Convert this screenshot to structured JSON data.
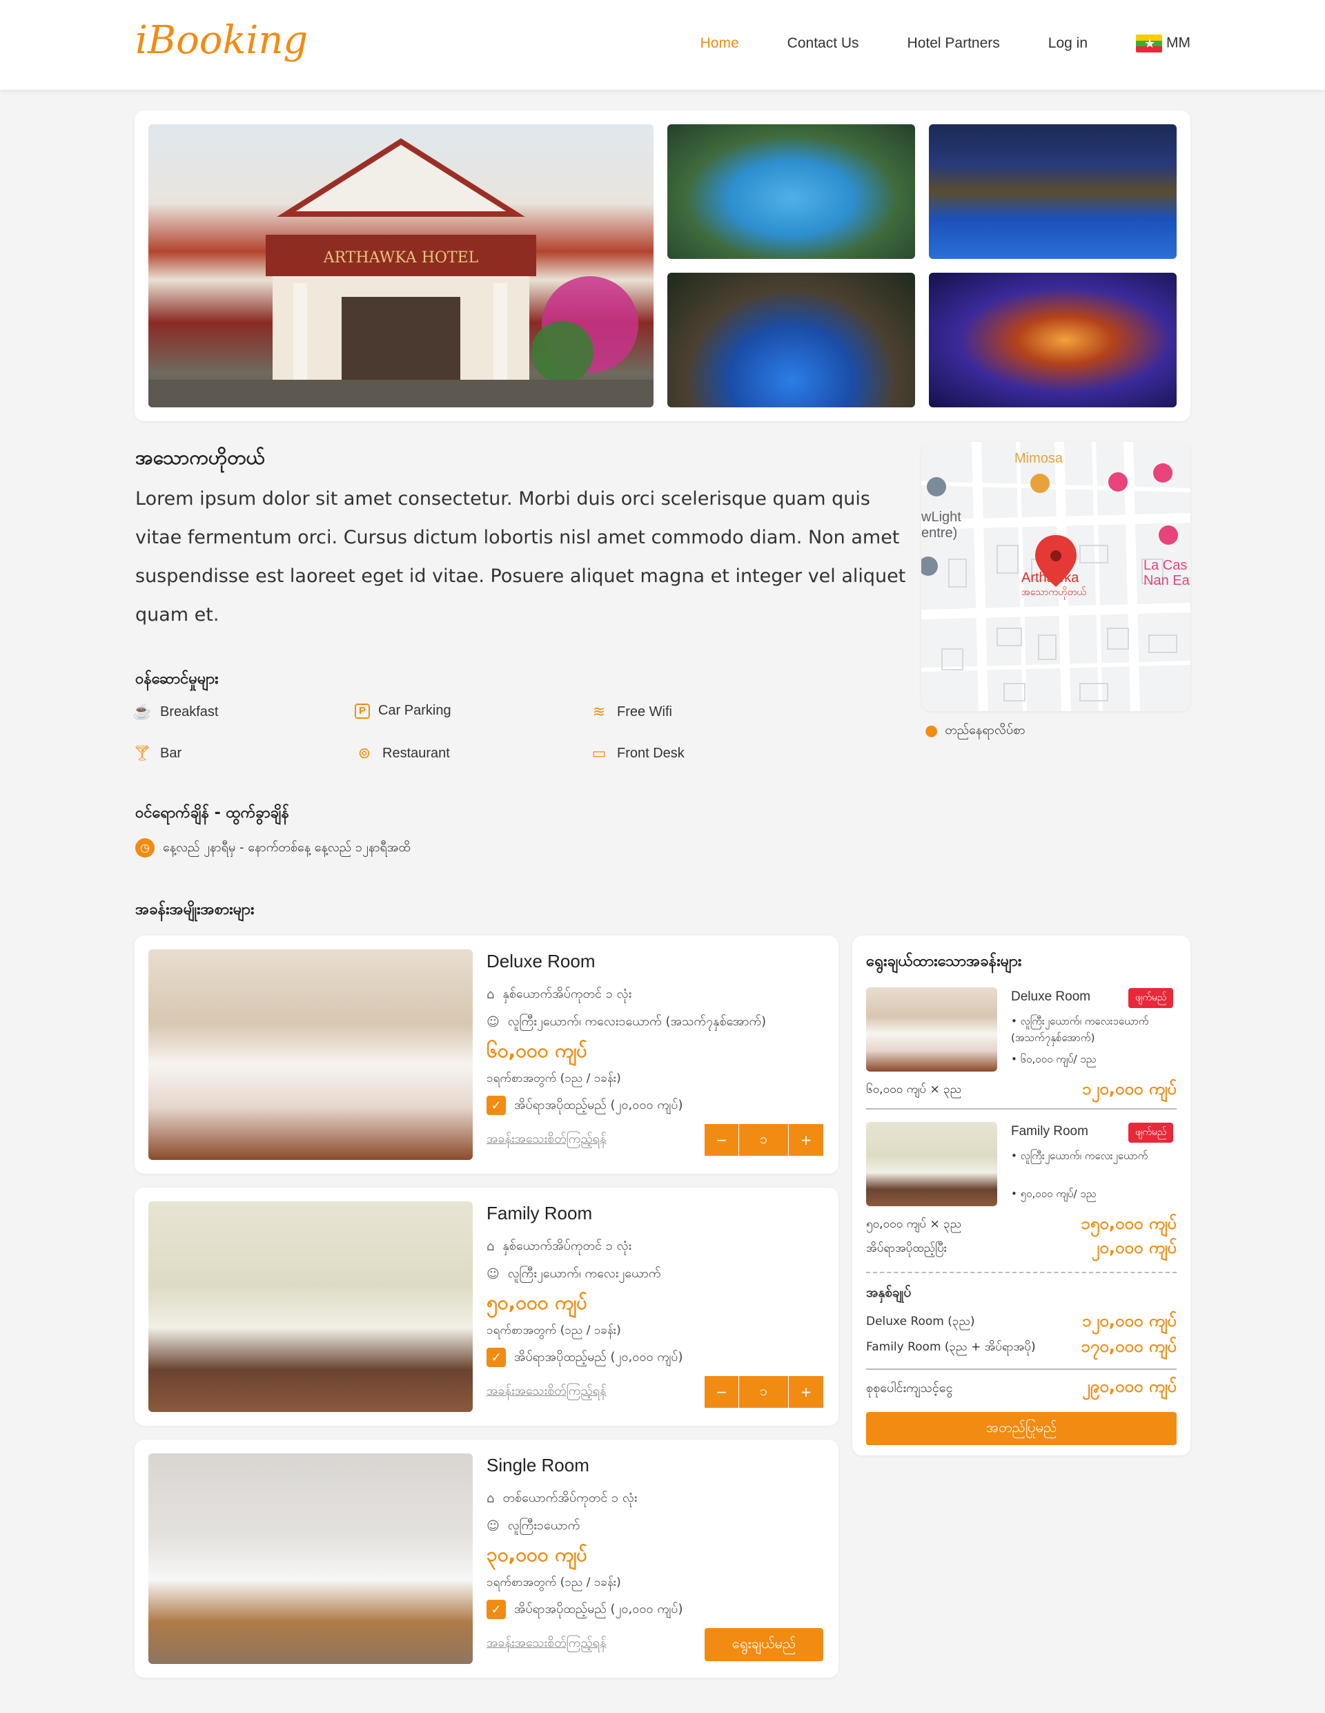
{
  "brand": {
    "logo": "iBooking",
    "accent": "#f28b12"
  },
  "nav": {
    "home": "Home",
    "contact": "Contact Us",
    "partners": "Hotel Partners",
    "login": "Log in",
    "lang": "MM"
  },
  "hotel": {
    "name": "အသောကဟိုတယ်",
    "description": "Lorem ipsum dolor sit amet consectetur. Morbi duis orci scelerisque quam quis vitae fermentum orci. Cursus dictum lobortis nisl amet commodo diam. Non amet suspendisse est laoreet eget id vitae. Posuere aliquet magna et integer vel aliquet quam et.",
    "photo_sign": "ARTHAWKA HOTEL",
    "map_link": "တည်နေရာလိပ်စာ",
    "map_labels": {
      "mimosa": "Mimosa",
      "arthawka": "Arthawka",
      "arthawka_mm": "အသောကဟိုတယ်",
      "lacasa": "La Cas",
      "nanea": "Nan Ea",
      "newlight": "wLight",
      "centre": "entre)"
    }
  },
  "services": {
    "title": "ဝန်ဆောင်မှုများ",
    "items": [
      {
        "label": "Breakfast",
        "icon": "coffee-icon"
      },
      {
        "label": "Car Parking",
        "icon": "parking-icon"
      },
      {
        "label": "Free Wifi",
        "icon": "wifi-icon"
      },
      {
        "label": "Bar",
        "icon": "cocktail-icon"
      },
      {
        "label": "Restaurant",
        "icon": "restaurant-icon"
      },
      {
        "label": "Front Desk",
        "icon": "front-desk-icon"
      }
    ]
  },
  "checkin": {
    "title": "ဝင်ရောက်ချိန် - ထွက်ခွာချိန်",
    "text": "နေ့လည် ၂နာရီမှ - နောက်တစ်နေ့ နေ့လည် ၁၂နာရီအထိ"
  },
  "rooms_title": "အခန်းအမျိုးအစားများ",
  "rooms": [
    {
      "name": "Deluxe Room",
      "beds": "နှစ်ယောက်အိပ်ကုတင် ၁ လုံး",
      "guests": "လူကြီး၂ယောက်၊ ကလေး၁ယောက် (အသက်၇နှစ်အောက်)",
      "price": "၆၀,၀၀၀ ကျပ်",
      "per": "၁ရက်စာအတွက် (၁ည / ၁ခန်း)",
      "extra_bed": "အိပ်ရာအပိုထည့်မည် (၂၀,၀၀၀ ကျပ်)",
      "details": "အခန်းအသေးစိတ်ကြည့်ရန်",
      "qty": "၁"
    },
    {
      "name": "Family Room",
      "beds": "နှစ်ယောက်အိပ်ကုတင် ၁ လုံး",
      "guests": "လူကြီး၂ယောက်၊ ကလေး၂ယောက်",
      "price": "၅၀,၀၀၀ ကျပ်",
      "per": "၁ရက်စာအတွက် (၁ည / ၁ခန်း)",
      "extra_bed": "အိပ်ရာအပိုထည့်မည် (၂၀,၀၀၀ ကျပ်)",
      "details": "အခန်းအသေးစိတ်ကြည့်ရန်",
      "qty": "၁"
    },
    {
      "name": "Single Room",
      "beds": "တစ်ယောက်အိပ်ကုတင် ၁ လုံး",
      "guests": "လူကြီး၁ယောက်",
      "price": "၃၀,၀၀၀ ကျပ်",
      "per": "၁ရက်စာအတွက် (၁ည / ၁ခန်း)",
      "extra_bed": "အိပ်ရာအပိုထည့်မည် (၂၀,၀၀၀ ကျပ်)",
      "details": "အခန်းအသေးစိတ်ကြည့်ရန်",
      "select": "ရွေးချယ်မည်"
    }
  ],
  "stepper": {
    "minus": "−",
    "plus": "+"
  },
  "selected": {
    "title": "ရွေးချယ်ထားသောအခန်းများ",
    "remove": "ဖျက်မည်",
    "items": [
      {
        "name": "Deluxe Room",
        "guests": "လူကြီး၂ယောက်၊ ကလေး၁ယောက် (အသက်၇နှစ်အောက်)",
        "rate": "၆၀,၀၀၀ ကျပ်/ ၁ည",
        "calc": "၆၀,၀၀၀ ကျပ် × ၃ည",
        "total": "၁၂၀,၀၀၀ ကျပ်"
      },
      {
        "name": "Family Room",
        "guests": "လူကြီး၂ယောက်၊ ကလေး၂ယောက်",
        "rate": "၅၀,၀၀၀ ကျပ်/ ၁ည",
        "calc": "၅၀,၀၀၀ ကျပ် × ၃ည",
        "total": "၁၅၀,၀၀၀ ကျပ်",
        "extra_label": "အိပ်ရာအပိုထည့်ပြီး",
        "extra_total": "၂၀,၀၀၀ ကျပ်"
      }
    ],
    "summary_title": "အနှစ်ချုပ်",
    "summary": [
      {
        "label": "Deluxe Room (၃ည)",
        "value": "၁၂၀,၀၀၀ ကျပ်"
      },
      {
        "label": "Family Room (၃ည + အိပ်ရာအပို)",
        "value": "၁၇၀,၀၀၀ ကျပ်"
      }
    ],
    "grand_label": "စုစုပေါင်းကျသင့်ငွေ",
    "grand_total": "၂၉၀,၀၀၀ ကျပ်",
    "confirm": "အတည်ပြုမည်"
  }
}
